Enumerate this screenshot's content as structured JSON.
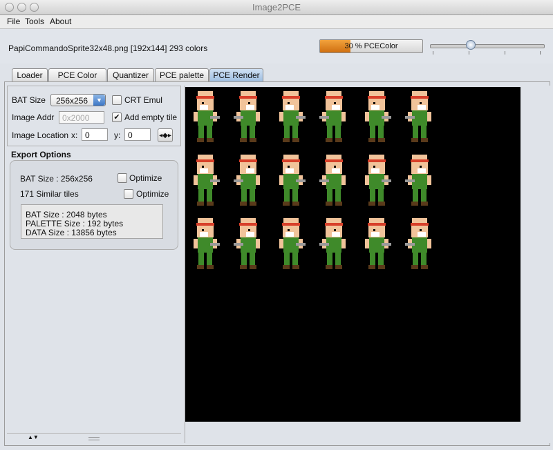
{
  "window": {
    "title": "Image2PCE"
  },
  "menu": {
    "file": "File",
    "tools": "Tools",
    "about": "About"
  },
  "info": {
    "filename": "PapiCommandoSprite32x48.png [192x144] 293 colors",
    "progress_label": "30 % PCEColor",
    "progress_value": 30,
    "slider_value": 0.35
  },
  "tabs": [
    {
      "label": "Loader"
    },
    {
      "label": "PCE Color"
    },
    {
      "label": "Quantizer"
    },
    {
      "label": "PCE palette"
    },
    {
      "label": "PCE Render"
    }
  ],
  "active_tab": "PCE Render",
  "settings": {
    "bat_size_label": "BAT Size",
    "bat_size_value": "256x256",
    "crt_emul_label": "CRT Emul",
    "crt_emul_checked": false,
    "image_addr_label": "Image Addr",
    "image_addr_placeholder": "0x2000",
    "add_empty_tile_label": "Add empty tile",
    "add_empty_tile_checked": true,
    "image_location_label": "Image Location",
    "x_label": "x:",
    "x_value": "0",
    "y_label": "y:",
    "y_value": "0"
  },
  "export": {
    "header": "Export Options",
    "bat_size_text": "BAT Size : 256x256",
    "optimize_label_1": "Optimize",
    "similar_tiles": "171 Similar tiles",
    "optimize_label_2": "Optimize",
    "bat_bytes": "BAT Size : 2048 bytes",
    "palette_bytes": "PALETTE Size : 192 bytes",
    "data_bytes": "DATA Size : 13856 bytes"
  },
  "colors": {
    "skin": "#f1c39a",
    "headband": "#d8402a",
    "uniform": "#3f8a2a",
    "boots": "#5a3a1a",
    "gun": "#9a9a9a"
  }
}
